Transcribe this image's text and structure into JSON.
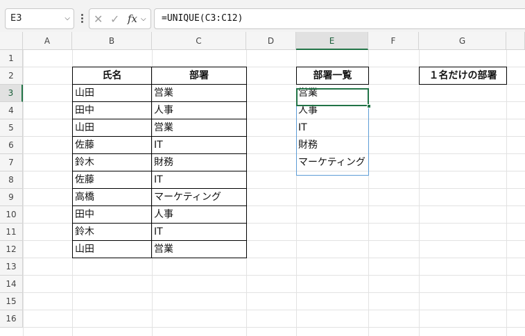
{
  "formula_bar": {
    "name_box": "E3",
    "formula": "=UNIQUE(C3:C12)",
    "fx_label": "fx"
  },
  "columns": [
    "A",
    "B",
    "C",
    "D",
    "E",
    "F",
    "G"
  ],
  "rows": [
    "1",
    "2",
    "3",
    "4",
    "5",
    "6",
    "7",
    "8",
    "9",
    "10",
    "11",
    "12",
    "13",
    "14",
    "15",
    "16"
  ],
  "selected_cell": "E3",
  "table": {
    "header_name": "氏名",
    "header_dept": "部署",
    "rows": [
      {
        "name": "山田",
        "dept": "営業"
      },
      {
        "name": "田中",
        "dept": "人事"
      },
      {
        "name": "山田",
        "dept": "営業"
      },
      {
        "name": "佐藤",
        "dept": "IT"
      },
      {
        "name": "鈴木",
        "dept": "財務"
      },
      {
        "name": "佐藤",
        "dept": "IT"
      },
      {
        "name": "高橋",
        "dept": "マーケティング"
      },
      {
        "name": "田中",
        "dept": "人事"
      },
      {
        "name": "鈴木",
        "dept": "IT"
      },
      {
        "name": "山田",
        "dept": "営業"
      }
    ]
  },
  "dept_list": {
    "header": "部署一覧",
    "items": [
      "営業",
      "人事",
      "IT",
      "財務",
      "マーケティング"
    ]
  },
  "single_dept_header": "１名だけの部署",
  "colors": {
    "accent": "#217346",
    "spill_border": "#5b9bd5"
  }
}
